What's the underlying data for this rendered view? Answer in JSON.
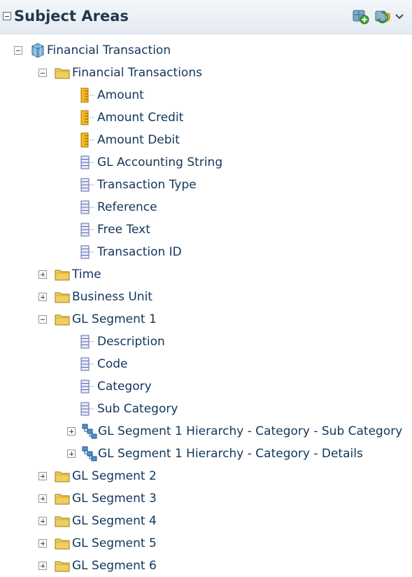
{
  "header": {
    "title": "Subject Areas",
    "add_icon": "add-subject-area-icon",
    "refresh_icon": "refresh-icon",
    "menu_icon": "chevron-down-icon"
  },
  "tree": {
    "root": {
      "label": "Financial Transaction",
      "icon": "cube-icon",
      "expanded": true
    },
    "financial_transactions": {
      "label": "Financial Transactions",
      "icon": "folder-icon",
      "expanded": true,
      "measures": [
        "Amount",
        "Amount Credit",
        "Amount Debit"
      ],
      "attributes": [
        "GL Accounting String",
        "Transaction Type",
        "Reference",
        "Free Text",
        "Transaction ID"
      ]
    },
    "time": {
      "label": "Time",
      "icon": "folder-icon",
      "expanded": false
    },
    "business_unit": {
      "label": "Business Unit",
      "icon": "folder-icon",
      "expanded": false
    },
    "gl_segment_1": {
      "label": "GL Segment 1",
      "icon": "folder-icon",
      "expanded": true,
      "attributes": [
        "Description",
        "Code",
        "Category",
        "Sub Category"
      ],
      "hierarchies": [
        "GL Segment 1 Hierarchy - Category - Sub Category",
        "GL Segment 1 Hierarchy - Category - Details"
      ]
    },
    "other_folders": [
      "GL Segment 2",
      "GL Segment 3",
      "GL Segment 4",
      "GL Segment 5",
      "GL Segment 6"
    ]
  },
  "colors": {
    "text": "#12365a",
    "header_bg": "#e3eaf1",
    "folder": "#f2cf5c",
    "measure": "#f5b81c",
    "attribute": "#6f7bc9"
  }
}
